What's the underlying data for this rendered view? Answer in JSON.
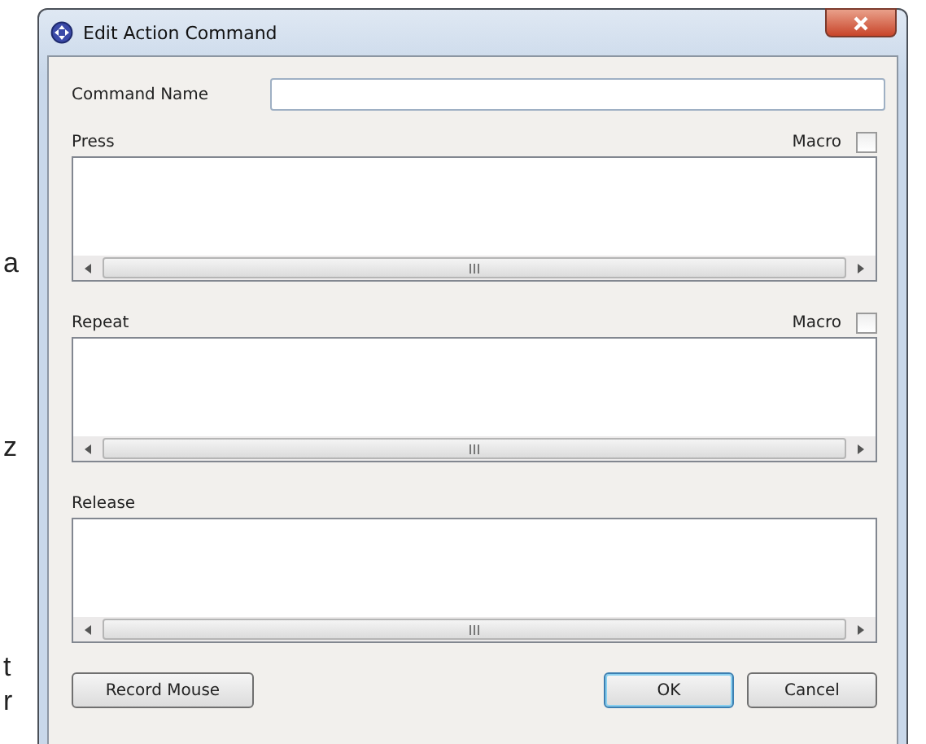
{
  "background_text": [
    "a",
    "z",
    "t",
    "r"
  ],
  "window": {
    "title": "Edit Action Command"
  },
  "command_name": {
    "label": "Command Name"
  },
  "sections": [
    {
      "label": "Press",
      "macro": {
        "label": "Macro",
        "checked": false
      }
    },
    {
      "label": "Repeat",
      "macro": {
        "label": "Macro",
        "checked": false
      }
    },
    {
      "label": "Release"
    }
  ],
  "buttons": [
    {
      "label": "Record Mouse",
      "kind": "left",
      "default": false
    },
    {
      "label": "OK",
      "kind": "right",
      "default": true
    },
    {
      "label": "Cancel",
      "kind": "right",
      "default": false
    }
  ]
}
